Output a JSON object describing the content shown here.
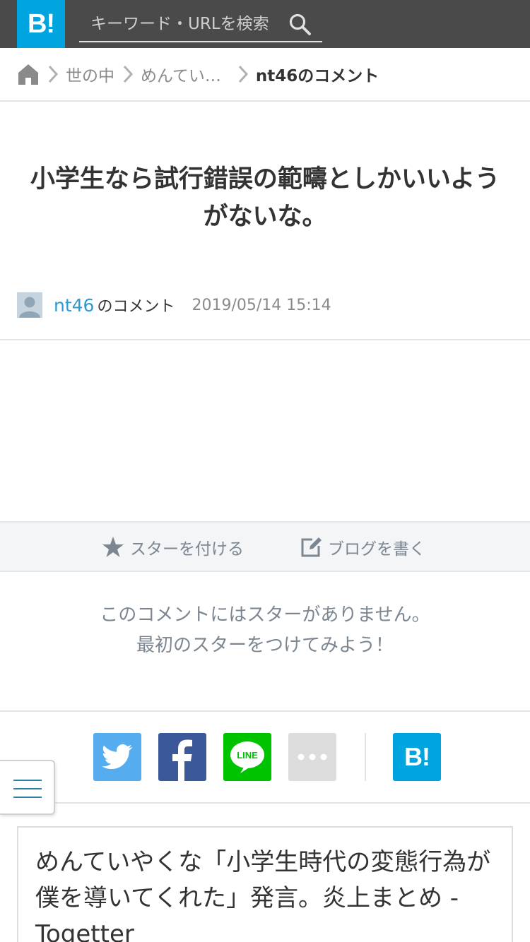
{
  "header": {
    "logo_text": "B!",
    "search_placeholder": "キーワード・URLを検索",
    "bg_color": "#4a4a4a",
    "logo_color": "#00a4de"
  },
  "breadcrumb": {
    "items": [
      {
        "label": "世の中"
      },
      {
        "label": "めんてい…"
      }
    ],
    "current": "nt46のコメント"
  },
  "comment": {
    "text": "小学生なら試行錯誤の範疇としかいいようがないな。",
    "user": "nt46",
    "user_suffix": "のコメント",
    "date": "2019/05/14 15:14"
  },
  "actions": {
    "star_label": "スターを付ける",
    "blog_label": "ブログを書く"
  },
  "stars": {
    "empty_line1": "このコメントにはスターがありません。",
    "empty_line2": "最初のスターをつけてみよう！"
  },
  "share": {
    "twitter_color": "#55acee",
    "facebook_color": "#3b5998",
    "line_color": "#00c300",
    "line_text": "LINE",
    "hatena_text": "B!"
  },
  "entry": {
    "title": "めんていやくな「小学生時代の変態行為が僕を導いてくれた」発言。炎上まとめ - Togetter"
  }
}
